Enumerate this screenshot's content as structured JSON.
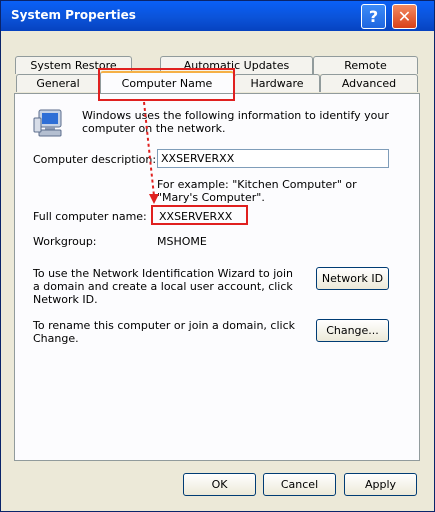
{
  "window": {
    "title": "System Properties"
  },
  "caption": {
    "help": "?",
    "close": "✕"
  },
  "tabs": {
    "row1": [
      "System Restore",
      "Automatic Updates",
      "Remote"
    ],
    "row2": [
      "General",
      "Computer Name",
      "Hardware",
      "Advanced"
    ],
    "active": "Computer Name"
  },
  "page": {
    "intro": "Windows uses the following information to identify your computer on the network.",
    "description_label": "Computer description:",
    "description_value": "XXSERVERXX",
    "example": "For example: \"Kitchen Computer\" or \"Mary's Computer\".",
    "full_name_label": "Full computer name:",
    "full_name_value": "XXSERVERXX",
    "workgroup_label": "Workgroup:",
    "workgroup_value": "MSHOME",
    "wizard_text": "To use the Network Identification Wizard to join a domain and create a local user account, click Network ID.",
    "network_id_button": "Network ID",
    "rename_text": "To rename this computer or join a domain, click Change.",
    "change_button": "Change..."
  },
  "footer": {
    "ok": "OK",
    "cancel": "Cancel",
    "apply": "Apply"
  },
  "colors": {
    "highlight": "#e0201f",
    "title_bar": "#0b53d9"
  },
  "icons": {
    "computer": "computer-icon"
  }
}
